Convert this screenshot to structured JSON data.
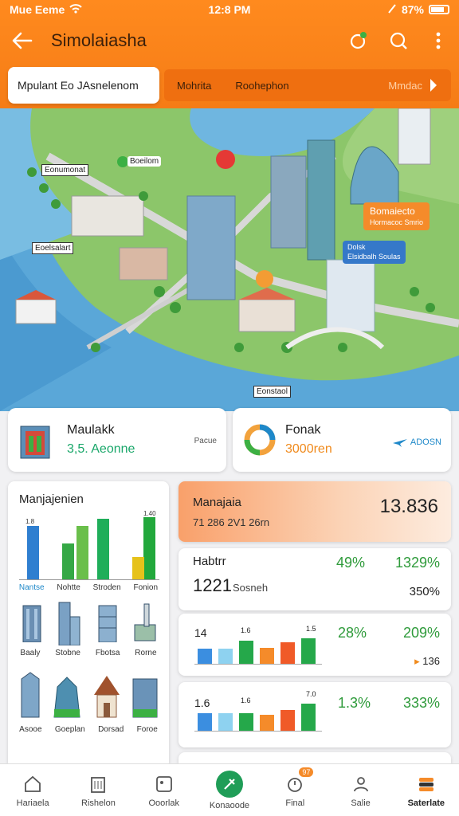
{
  "status": {
    "carrier": "Mue Eeme",
    "time": "12:8 PM",
    "battery": "87%"
  },
  "appbar": {
    "title": "Simolaiasha"
  },
  "search": {
    "text": "Mpulant Eo JAsnelenom"
  },
  "tabs": [
    {
      "label": "Mohrita"
    },
    {
      "label": "Roohephon"
    }
  ],
  "tab_more": {
    "label": "Mmdac"
  },
  "map": {
    "labels": [
      {
        "text": "Eonumonat"
      },
      {
        "text": "Eoelsalart"
      },
      {
        "text": "Eonstaol"
      }
    ],
    "pin_label": {
      "text": "Boeilom"
    },
    "callout": {
      "line1": "Bomaiecto",
      "line2": "Hormacoc Smrio"
    },
    "info": {
      "line1": "Dolsk",
      "line2": "Elsidbalh Soulas"
    }
  },
  "summary": [
    {
      "name": "Maulakk",
      "value": "3,5. Aeonne",
      "aside": "Pacue"
    },
    {
      "name": "Fonak",
      "value": "3000ren",
      "aside": "ADOSN"
    }
  ],
  "left_panel": {
    "title": "Manjajenien",
    "chart_numbers": [
      "1.8",
      "1.40"
    ],
    "categories": [
      "Nantse",
      "Nohtte",
      "Stroden",
      "Fonion"
    ],
    "buildings_row1": [
      "Baaly",
      "Stobne",
      "Fbotsa",
      "Rorne"
    ],
    "buildings_row2": [
      "Asooe",
      "Goeplan",
      "Dorsad",
      "Foroe"
    ]
  },
  "right_cards": {
    "top": {
      "title": "Manajaia",
      "sub": "71 286 2V1 26rn",
      "big": "13.836"
    },
    "second": {
      "title": "Habtrr",
      "value": "1221",
      "unit": "Sosneh",
      "pct1": "49%",
      "pct2": "1329%",
      "sub2": "350%"
    },
    "third": {
      "num": "14",
      "n2": "1.6",
      "n3": "1.5",
      "pct1": "28%",
      "pct2": "209%",
      "sub2": "136"
    },
    "fourth": {
      "num": "1.6",
      "n2": "1.6",
      "n3": "7.0",
      "pct1": "1.3%",
      "pct2": "333%"
    }
  },
  "chart_data": [
    {
      "type": "bar",
      "categories": [
        "Nantse",
        "Nohtte",
        "Stroden",
        "Fonion"
      ],
      "series": [
        {
          "values": [
            1.2,
            0.8,
            1.35,
            1.4
          ]
        },
        {
          "values": [
            0,
            1.2,
            0,
            0.5
          ]
        }
      ]
    },
    {
      "type": "bar",
      "values": [
        0.55,
        0.55,
        0.85,
        0.6,
        0.8,
        0.95
      ]
    },
    {
      "type": "bar",
      "values": [
        0.65,
        0.65,
        0.65,
        0.6,
        0.75,
        1.0
      ]
    }
  ],
  "nav": [
    {
      "label": "Hariaela"
    },
    {
      "label": "Rishelon"
    },
    {
      "label": "Ooorlak"
    },
    {
      "label": "Konaoode"
    },
    {
      "label": "Final",
      "badge": "97"
    },
    {
      "label": "Salie"
    },
    {
      "label": "Saterlate"
    }
  ]
}
